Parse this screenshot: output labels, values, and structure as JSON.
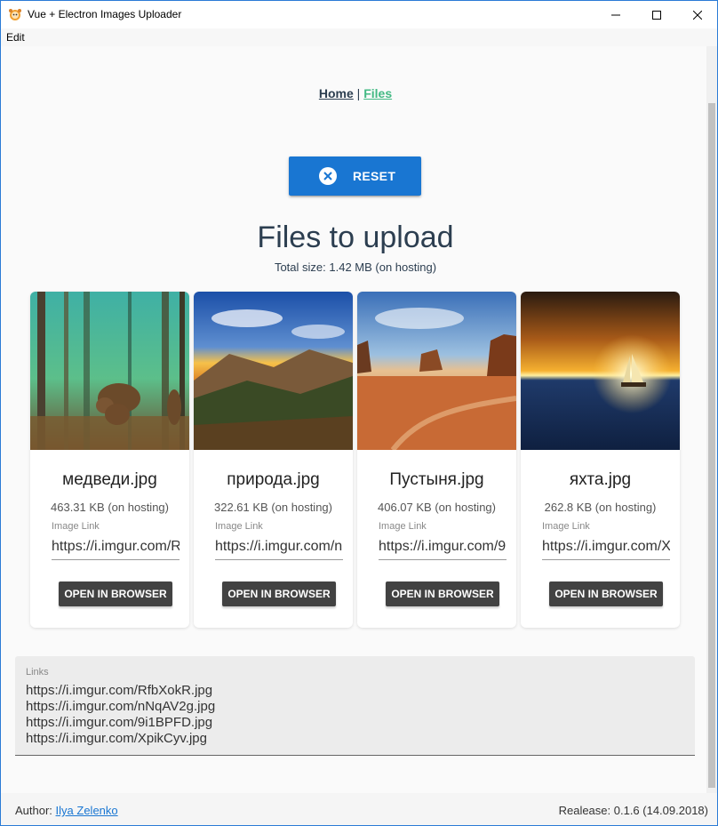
{
  "window": {
    "title": "Vue + Electron Images Uploader"
  },
  "menu": {
    "edit": "Edit"
  },
  "nav": {
    "home": "Home",
    "separator": "|",
    "files": "Files"
  },
  "reset_button": {
    "label": "RESET",
    "icon": "close-circle-icon"
  },
  "main": {
    "title": "Files to upload",
    "total_size": "Total size: 1.42 MB (on hosting)"
  },
  "files": [
    {
      "name": "медведи.jpg",
      "size": "463.31 KB (on hosting)",
      "link_label": "Image Link",
      "link": "https://i.imgur.com/RfbXokR.jpg",
      "button": "OPEN IN BROWSER"
    },
    {
      "name": "природа.jpg",
      "size": "322.61 KB (on hosting)",
      "link_label": "Image Link",
      "link": "https://i.imgur.com/nNqAV2g.jpg",
      "button": "OPEN IN BROWSER"
    },
    {
      "name": "Пустыня.jpg",
      "size": "406.07 KB (on hosting)",
      "link_label": "Image Link",
      "link": "https://i.imgur.com/9i1BPFD.jpg",
      "button": "OPEN IN BROWSER"
    },
    {
      "name": "яхта.jpg",
      "size": "262.8 KB (on hosting)",
      "link_label": "Image Link",
      "link": "https://i.imgur.com/XpikCyv.jpg",
      "button": "OPEN IN BROWSER"
    }
  ],
  "links": {
    "label": "Links",
    "text": "https://i.imgur.com/RfbXokR.jpg\nhttps://i.imgur.com/nNqAV2g.jpg\nhttps://i.imgur.com/9i1BPFD.jpg\nhttps://i.imgur.com/XpikCyv.jpg"
  },
  "footer": {
    "author_prefix": "Author:",
    "author_name": "Ilya Zelenko",
    "release": "Realease: 0.1.6 (14.09.2018)"
  },
  "colors": {
    "accent": "#1976d2",
    "nav_active": "#42b983",
    "button_dark": "#424242"
  }
}
